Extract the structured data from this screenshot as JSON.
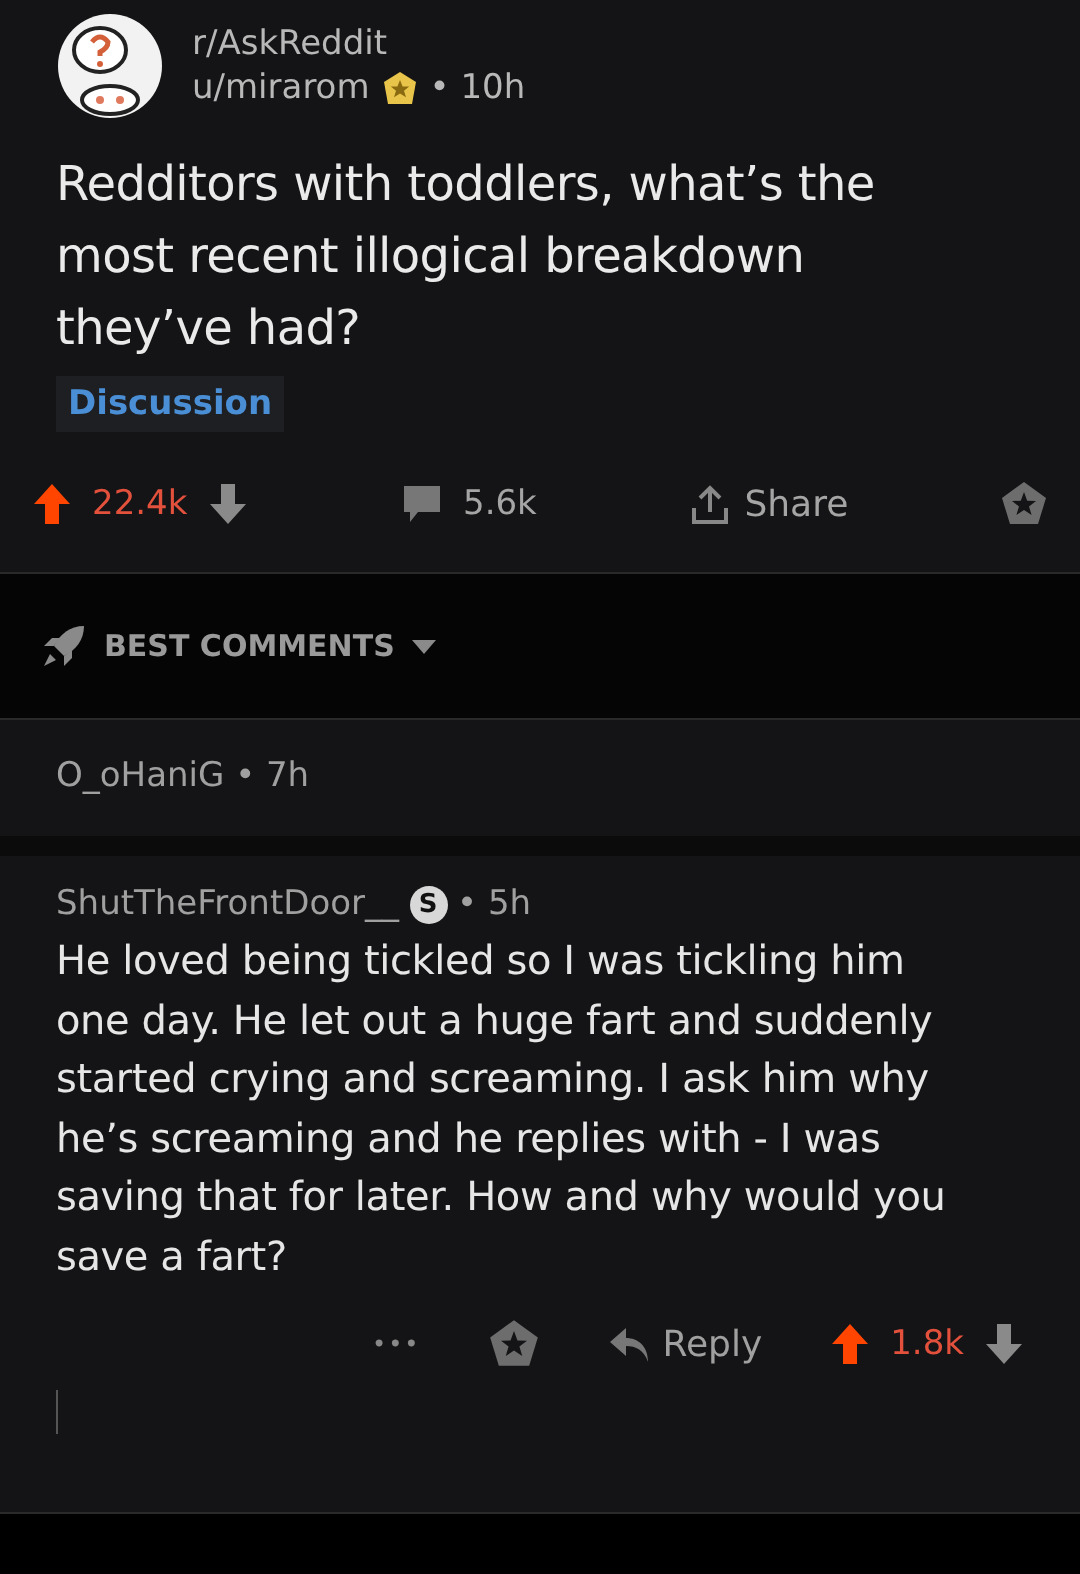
{
  "post": {
    "subreddit": "r/AskReddit",
    "author": "u/mirarom",
    "time": "• 10h",
    "title": "Redditors with toddlers, what’s the most recent illogical breakdown they’ve had?",
    "flair": "Discussion",
    "upvoted": true,
    "score": "22.4k",
    "comments": "5.6k",
    "share": "Share"
  },
  "sort": {
    "label": "BEST COMMENTS"
  },
  "comments": [
    {
      "author": "O_oHaniG",
      "time": "• 7h",
      "collapsed": true
    },
    {
      "author": "ShutTheFrontDoor__",
      "time": "• 5h",
      "collapsed": false,
      "badge": "S",
      "body": "He loved being tickled so I was tickling him one day. He let out a huge fart and suddenly started crying and screaming. I ask him why he’s screaming and he replies with - I was saving that for later. How and why would you save a fart?",
      "more": "•••",
      "reply": "Reply",
      "upvoted": true,
      "score": "1.8k"
    }
  ]
}
